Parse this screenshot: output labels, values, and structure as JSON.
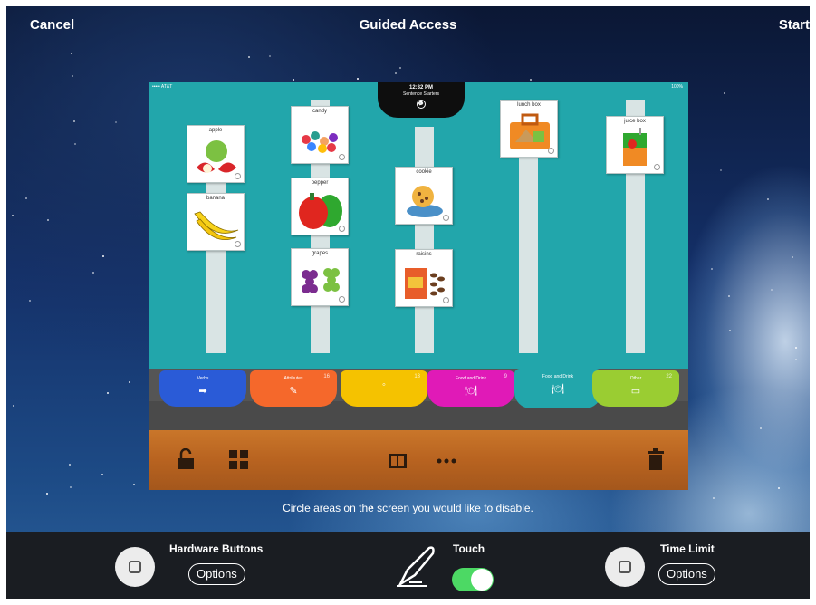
{
  "topbar": {
    "cancel_label": "Cancel",
    "title": "Guided Access",
    "start_label": "Start"
  },
  "app": {
    "status": {
      "carrier": "••••• AT&T",
      "time": "12:32 PM",
      "battery": "100%"
    },
    "notch_title": "Sentence Starters",
    "cards": {
      "apple": "apple",
      "banana": "banana",
      "candy": "candy",
      "pepper": "pepper",
      "grapes": "grapes",
      "cookie": "cookie",
      "raisins": "raisins",
      "lunch_box": "lunch box",
      "juice_box": "juice box"
    },
    "tabs": [
      {
        "label": "Verbs",
        "count": "",
        "color": "#2a5bd7"
      },
      {
        "label": "Attributes",
        "count": "16",
        "color": "#f5682b"
      },
      {
        "label": "",
        "count": "13",
        "color": "#f5c200"
      },
      {
        "label": "Food and Drink",
        "count": "9",
        "color": "#e01ab7"
      },
      {
        "label": "Food and Drink",
        "count": "",
        "color": "#22a6ab"
      },
      {
        "label": "Other",
        "count": "22",
        "color": "#9acd32"
      }
    ],
    "toolbar": {
      "lock_icon": "unlock-icon",
      "grid_icon": "grid-icon",
      "film_icon": "filmstrip-icon",
      "more_icon": "more-icon",
      "trash_icon": "trash-icon"
    }
  },
  "hint_text": "Circle areas on the screen you would like to disable.",
  "bottom": {
    "hardware_buttons_label": "Hardware Buttons",
    "hardware_options_label": "Options",
    "touch_label": "Touch",
    "touch_on": true,
    "time_limit_label": "Time Limit",
    "time_options_label": "Options"
  },
  "colors": {
    "accent_toggle": "#4cd964",
    "app_background": "#22a6ab"
  }
}
